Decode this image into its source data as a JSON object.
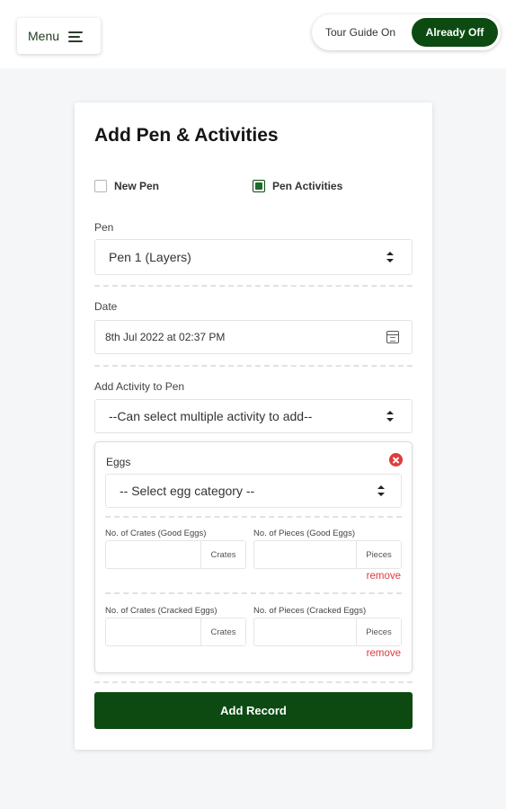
{
  "header": {
    "menu_label": "Menu",
    "tour_label": "Tour Guide On",
    "tour_toggle_label": "Already Off"
  },
  "form": {
    "title": "Add Pen & Activities",
    "options": [
      {
        "label": "New Pen",
        "checked": false
      },
      {
        "label": "Pen Activities",
        "checked": true
      }
    ],
    "pen_label": "Pen",
    "pen_value": "Pen 1 (Layers)",
    "date_label": "Date",
    "date_value": "8th Jul 2022 at 02:37 PM",
    "activity_label": "Add Activity to Pen",
    "activity_value": "--Can select multiple activity to add--",
    "submit_label": "Add Record"
  },
  "eggs_panel": {
    "title": "Eggs",
    "category_value": "-- Select egg category --",
    "rows": [
      {
        "crates_label": "No. of Crates (Good Eggs)",
        "crates_unit": "Crates",
        "pieces_label": "No. of Pieces (Good Eggs)",
        "pieces_unit": "Pieces",
        "remove_label": "remove"
      },
      {
        "crates_label": "No. of Crates (Cracked Eggs)",
        "crates_unit": "Crates",
        "pieces_label": "No. of Pieces (Cracked Eggs)",
        "pieces_unit": "Pieces",
        "remove_label": "remove"
      }
    ]
  },
  "colors": {
    "brand_green": "#0c4a12",
    "danger_red": "#e03b3b"
  }
}
